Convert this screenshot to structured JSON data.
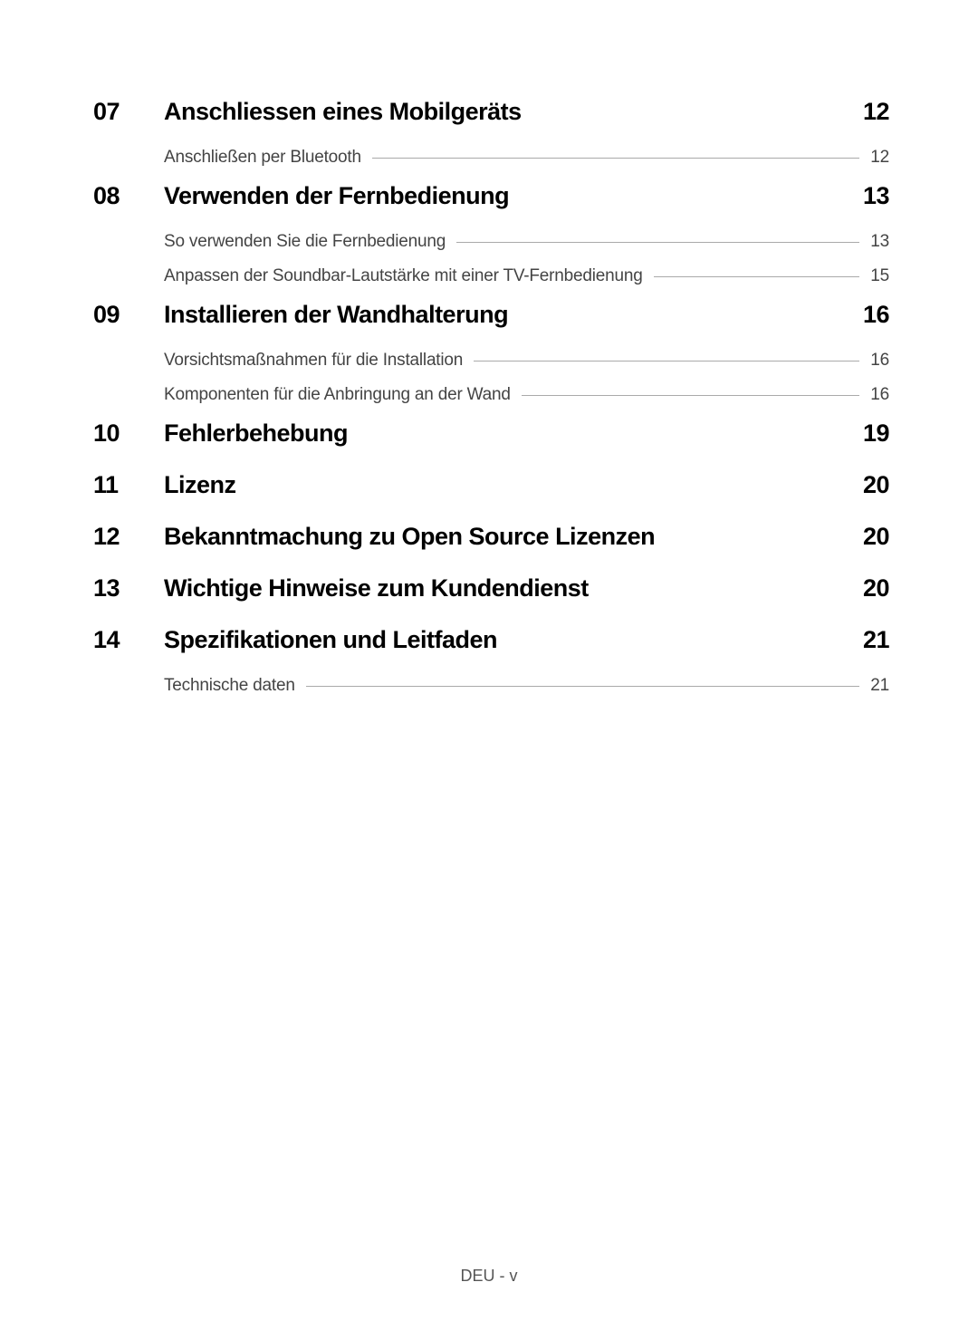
{
  "toc": [
    {
      "number": "07",
      "title": "Anschliessen eines Mobilgeräts",
      "page": "12",
      "subsections": [
        {
          "title": "Anschließen per Bluetooth",
          "page": "12"
        }
      ]
    },
    {
      "number": "08",
      "title": "Verwenden der Fernbedienung",
      "page": "13",
      "subsections": [
        {
          "title": "So verwenden Sie die Fernbedienung",
          "page": "13"
        },
        {
          "title": "Anpassen der Soundbar-Lautstärke mit einer TV-Fernbedienung",
          "page": "15"
        }
      ]
    },
    {
      "number": "09",
      "title": "Installieren der Wandhalterung",
      "page": "16",
      "subsections": [
        {
          "title": "Vorsichtsmaßnahmen für die Installation",
          "page": "16"
        },
        {
          "title": "Komponenten für die Anbringung an der Wand",
          "page": "16"
        }
      ]
    },
    {
      "number": "10",
      "title": "Fehlerbehebung",
      "page": "19",
      "subsections": []
    },
    {
      "number": "11",
      "title": "Lizenz",
      "page": "20",
      "subsections": []
    },
    {
      "number": "12",
      "title": "Bekanntmachung zu Open Source Lizenzen",
      "page": "20",
      "subsections": []
    },
    {
      "number": "13",
      "title": "Wichtige Hinweise zum Kundendienst",
      "page": "20",
      "subsections": []
    },
    {
      "number": "14",
      "title": "Spezifikationen und Leitfaden",
      "page": "21",
      "subsections": [
        {
          "title": "Technische daten",
          "page": "21"
        }
      ]
    }
  ],
  "footer": "DEU - v"
}
